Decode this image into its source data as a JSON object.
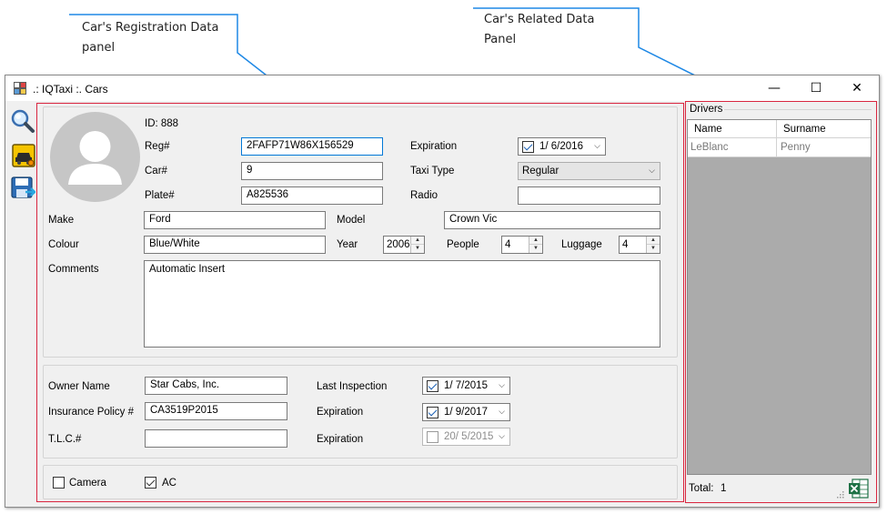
{
  "callouts": {
    "registration_panel_line1": "Car's Registration Data",
    "registration_panel_line2": "panel",
    "related_panel_line1": "Car's Related Data",
    "related_panel_line2": "Panel"
  },
  "window": {
    "title": ".: IQTaxi :. Cars",
    "minimize_glyph": "—",
    "maximize_glyph": "☐",
    "close_glyph": "✕"
  },
  "toolbar": {
    "icons": [
      "search-icon",
      "taxi-icon",
      "save-icon"
    ]
  },
  "registration": {
    "id_label": "ID: 888",
    "reg_label": "Reg#",
    "reg_value": "2FAFP71W86X156529",
    "car_label": "Car#",
    "car_value": "9",
    "plate_label": "Plate#",
    "plate_value": "A825536",
    "expiration_label": "Expiration",
    "expiration_value": "1/ 6/2016",
    "expiration_checked": true,
    "taxi_type_label": "Taxi Type",
    "taxi_type_value": "Regular",
    "radio_label": "Radio",
    "radio_value": "",
    "make_label": "Make",
    "make_value": "Ford",
    "model_label": "Model",
    "model_value": "Crown Vic",
    "colour_label": "Colour",
    "colour_value": "Blue/White",
    "year_label": "Year",
    "year_value": "2006",
    "people_label": "People",
    "people_value": "4",
    "luggage_label": "Luggage",
    "luggage_value": "4",
    "comments_label": "Comments",
    "comments_value": "Automatic Insert"
  },
  "owner": {
    "owner_name_label": "Owner Name",
    "owner_name_value": "Star Cabs, Inc.",
    "insurance_label": "Insurance Policy #",
    "insurance_value": "CA3519P2015",
    "tlc_label": "T.L.C.#",
    "tlc_value": "",
    "last_inspection_label": "Last Inspection",
    "last_inspection_value": "1/ 7/2015",
    "last_inspection_checked": true,
    "ins_expiration_label": "Expiration",
    "ins_expiration_value": "1/ 9/2017",
    "ins_expiration_checked": true,
    "tlc_expiration_label": "Expiration",
    "tlc_expiration_value": "20/ 5/2015",
    "tlc_expiration_checked": false
  },
  "options": {
    "camera_label": "Camera",
    "camera_checked": false,
    "ac_label": "AC",
    "ac_checked": true
  },
  "drivers": {
    "panel_title": "Drivers",
    "columns": [
      "Name",
      "Surname"
    ],
    "rows": [
      [
        "LeBlanc",
        "Penny"
      ]
    ],
    "total_label": "Total:",
    "total_value": "1",
    "export_icon": "excel-export-icon"
  },
  "colors": {
    "panel_border": "#d9263f",
    "callout_line": "#1e88e5",
    "window_bg": "#f0f0f0",
    "grid_bg": "#ababab"
  }
}
